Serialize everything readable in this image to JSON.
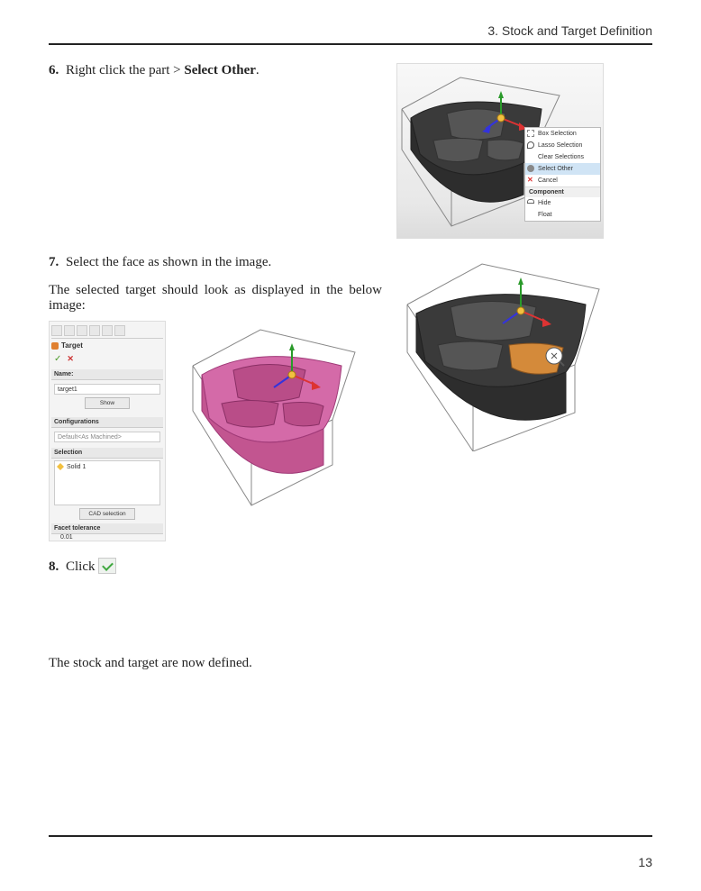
{
  "header": {
    "chapter_label": "3. Stock and Target Definition"
  },
  "steps": {
    "s6": {
      "num": "6.",
      "text_a": "Right click the part > ",
      "text_b_bold": "Select Other",
      "text_c": "."
    },
    "s7": {
      "num": "7.",
      "text": "Select the face as shown in the image."
    },
    "s7_followup": "The selected target should look as displayed in the below image:",
    "s8": {
      "num": "8.",
      "text": "Click"
    },
    "closing": "The stock and target are now defined."
  },
  "context_menu": {
    "items": [
      {
        "label": "Box Selection",
        "icon": "box"
      },
      {
        "label": "Lasso Selection",
        "icon": "lasso"
      },
      {
        "label": "Clear Selections"
      },
      {
        "label": "Select Other",
        "icon": "eye",
        "selected": true
      },
      {
        "label": "Cancel",
        "icon": "x"
      }
    ],
    "section_label": "Component",
    "section_items": [
      {
        "label": "Hide",
        "icon": "glasses"
      },
      {
        "label": "Float"
      }
    ]
  },
  "panel": {
    "title": "Target",
    "ok_icon": "✓",
    "cancel_icon": "✕",
    "name_header": "Name:",
    "name_value": "target1",
    "show_button": "Show",
    "config_header": "Configurations",
    "config_value": "Default<As Machined>",
    "selection_header": "Selection",
    "selection_item": "Solid 1",
    "cad_button": "CAD selection",
    "facet_header": "Facet  tolerance",
    "facet_value": "0.01"
  },
  "footer": {
    "page_number": "13"
  }
}
